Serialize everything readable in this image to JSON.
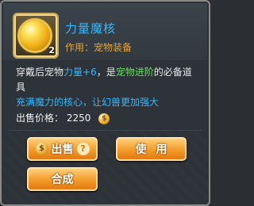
{
  "item": {
    "name": "力量魔核",
    "usage_label": "作用：",
    "usage_value": "宠物装备",
    "level": "2"
  },
  "description": {
    "prefix": "穿戴后宠物",
    "stat": "力量+6",
    "middle": "，是",
    "highlight": "宠物进阶",
    "suffix": "的必备道具",
    "flavor": "充满魔力的核心，让幻兽更加强大"
  },
  "price": {
    "label": "出售价格：",
    "value": "2250"
  },
  "buttons": {
    "sell": "出售",
    "use": "使用",
    "compose": "合成"
  },
  "colors": {
    "title": "#33b7ff",
    "usage": "#e0a443",
    "stat": "#33b7ff",
    "highlight": "#61e05a",
    "button": "#f39b2a"
  },
  "icons": [
    "magic-core-item-icon",
    "coin-icon",
    "help-icon"
  ]
}
